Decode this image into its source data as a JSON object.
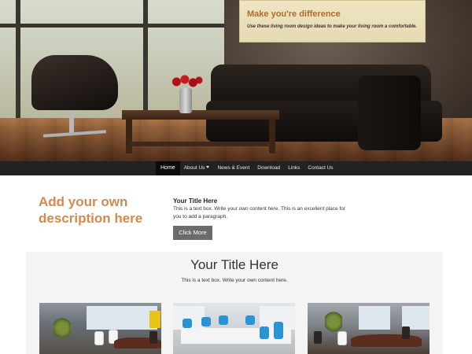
{
  "hero": {
    "promo_title": "Make you're difference",
    "promo_subtitle": "Use these living room design ideas to make your living room a comfortable."
  },
  "nav": {
    "items": [
      {
        "label": "Home",
        "active": true
      },
      {
        "label": "About Us",
        "dropdown": true
      },
      {
        "label": "News & Event"
      },
      {
        "label": "Download"
      },
      {
        "label": "Links"
      },
      {
        "label": "Contact Us"
      }
    ]
  },
  "intro": {
    "heading": "Add your own description here",
    "text_title": "Your Title Here",
    "text_body": "This is a text box. Write your own content here. This is an excellent place for you to add a paragraph.",
    "button_label": "Click More"
  },
  "section": {
    "title": "Your Title Here",
    "text": "This is a text box. Write your own content here."
  },
  "colors": {
    "accent": "#d28a4f",
    "promo_title": "#b26a2a",
    "navbar": "#222222",
    "button": "#6b6b6b",
    "section_bg": "#f4f4f4"
  }
}
